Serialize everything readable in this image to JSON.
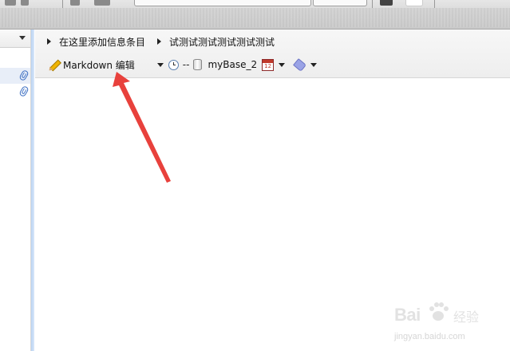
{
  "editor": {
    "breadcrumb": [
      "在这里添加信息条目",
      "试测试测试测试测试测试"
    ],
    "mode_label": "Markdown 编辑",
    "timestamp": "--",
    "base_name": "myBase_2"
  },
  "icons": {
    "attachment": "paperclip-icon",
    "edit_mode": "pencil-icon",
    "timestamp": "clock-icon",
    "database": "database-icon",
    "calendar": "calendar-icon",
    "tag": "tag-icon"
  },
  "colors": {
    "splitter": "#b9d3f3",
    "annotation_arrow": "#e8413c",
    "attachment_icon": "#3b6ec2"
  },
  "watermark": {
    "brand": "Bai",
    "brand_suffix": "经验",
    "url": "jingyan.baidu.com"
  }
}
